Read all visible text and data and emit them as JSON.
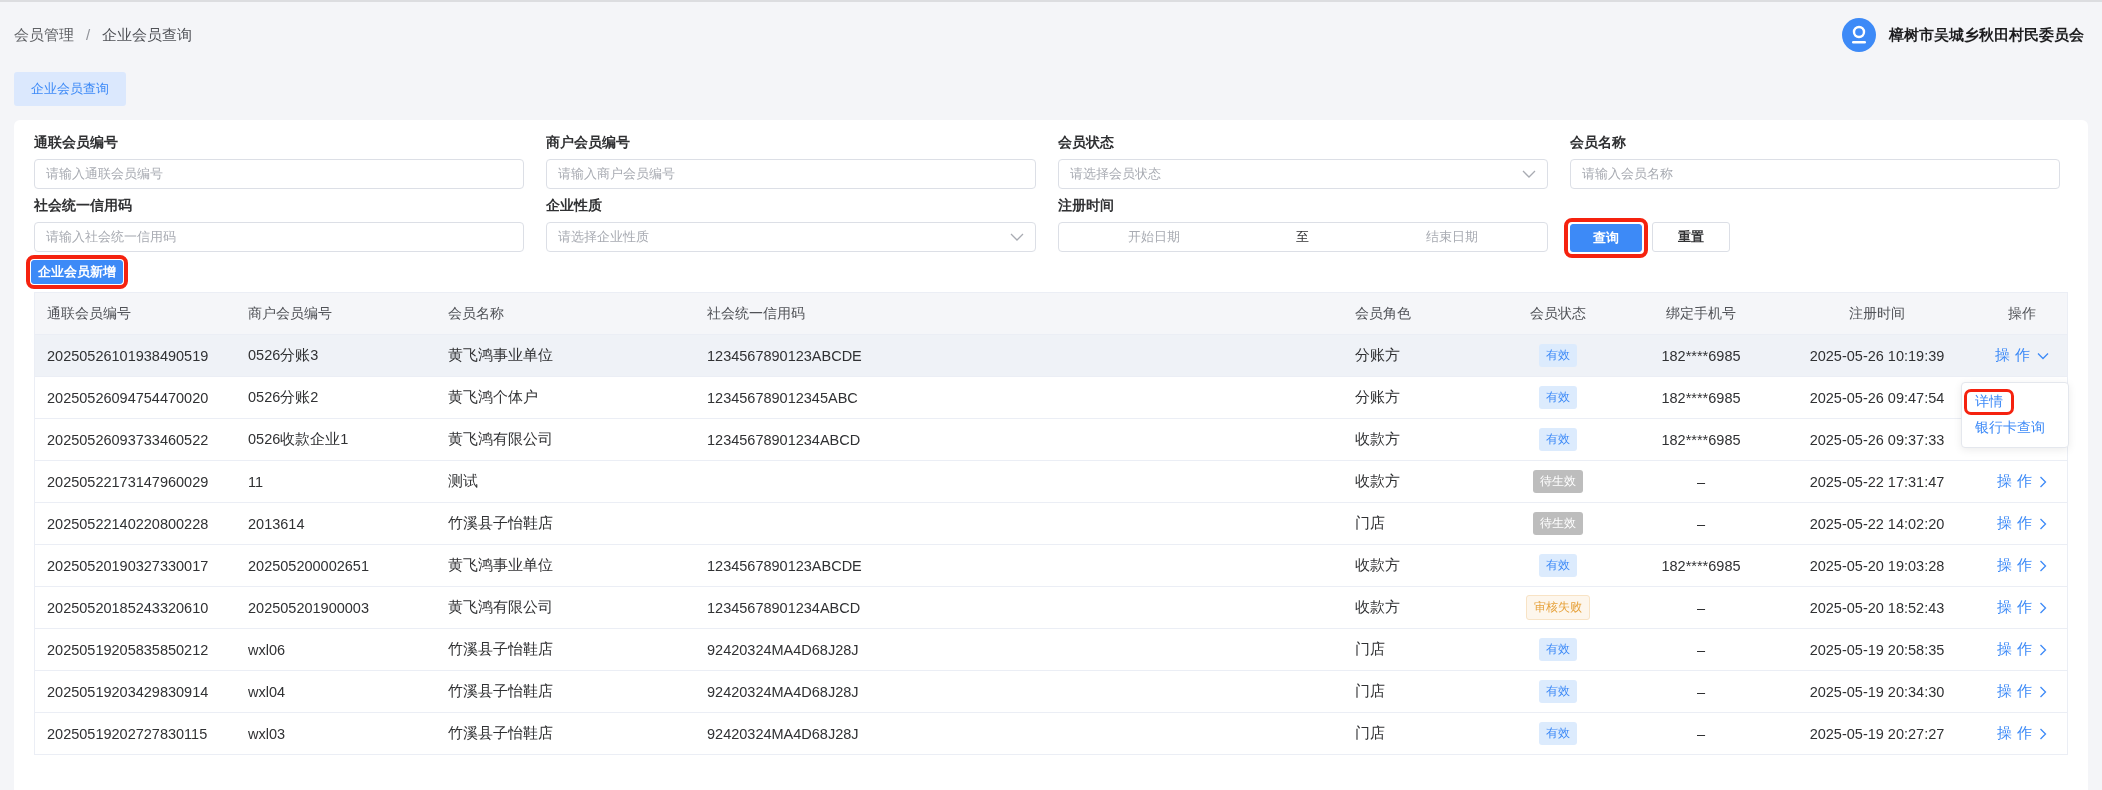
{
  "breadcrumb": [
    "会员管理",
    "企业会员查询"
  ],
  "breadcrumb_separator": "/",
  "user": {
    "name": "樟树市吴城乡秋田村民委员会"
  },
  "tabs": [
    {
      "label": "企业会员查询",
      "selected": true
    }
  ],
  "filters": [
    {
      "label": "通联会员编号",
      "kind": "input",
      "placeholder": "请输入通联会员编号"
    },
    {
      "label": "商户会员编号",
      "kind": "input",
      "placeholder": "请输入商户会员编号"
    },
    {
      "label": "会员状态",
      "kind": "select",
      "placeholder": "请选择会员状态"
    },
    {
      "label": "会员名称",
      "kind": "input",
      "placeholder": "请输入会员名称"
    },
    {
      "label": "社会统一信用码",
      "kind": "input",
      "placeholder": "请输入社会统一信用码"
    },
    {
      "label": "企业性质",
      "kind": "select",
      "placeholder": "请选择企业性质"
    },
    {
      "label": "注册时间",
      "kind": "daterange",
      "start_placeholder": "开始日期",
      "separator": "至",
      "end_placeholder": "结束日期"
    }
  ],
  "query_button": {
    "label": "查询",
    "highlighted": true
  },
  "reset_button": {
    "label": "重置"
  },
  "add_button": {
    "label": "企业会员新增",
    "highlighted": true
  },
  "table": {
    "columns": [
      "通联会员编号",
      "商户会员编号",
      "会员名称",
      "社会统一信用码",
      "会员角色",
      "会员状态",
      "绑定手机号",
      "注册时间",
      "操作"
    ],
    "rows": [
      {
        "id": "20250526101938490519",
        "merchant_id": "0526分账3",
        "name": "黄飞鸿事业单位",
        "credit_code": "1234567890123ABCDE",
        "role": "分账方",
        "status": {
          "label": "有效",
          "kind": "valid"
        },
        "phone": "182****6985",
        "registered": "2025-05-26 10:19:39",
        "action": "操 作",
        "expanded": true,
        "hovered": true
      },
      {
        "id": "20250526094754470020",
        "merchant_id": "0526分账2",
        "name": "黄飞鸿个体户",
        "credit_code": "123456789012345ABC",
        "role": "分账方",
        "status": {
          "label": "有效",
          "kind": "valid"
        },
        "phone": "182****6985",
        "registered": "2025-05-26 09:47:54",
        "expanded": false,
        "hovered": false
      },
      {
        "id": "20250526093733460522",
        "merchant_id": "0526收款企业1",
        "name": "黄飞鸿有限公司",
        "credit_code": "12345678901234ABCD",
        "role": "收款方",
        "status": {
          "label": "有效",
          "kind": "valid"
        },
        "phone": "182****6985",
        "registered": "2025-05-26 09:37:33",
        "expanded": false,
        "hovered": false
      },
      {
        "id": "20250522173147960029",
        "merchant_id": "11",
        "name": "测试",
        "role": "收款方",
        "status": {
          "label": "待生效",
          "kind": "pending"
        },
        "phone": "–",
        "registered": "2025-05-22 17:31:47",
        "action": "操 作",
        "expanded": false,
        "hovered": false
      },
      {
        "id": "20250522140220800228",
        "merchant_id": "2013614",
        "name": "竹溪县子怡鞋店",
        "role": "门店",
        "status": {
          "label": "待生效",
          "kind": "pending"
        },
        "phone": "–",
        "registered": "2025-05-22 14:02:20",
        "action": "操 作",
        "expanded": false,
        "hovered": false
      },
      {
        "id": "20250520190327330017",
        "merchant_id": "202505200002651",
        "name": "黄飞鸿事业单位",
        "credit_code": "1234567890123ABCDE",
        "role": "收款方",
        "status": {
          "label": "有效",
          "kind": "valid"
        },
        "phone": "182****6985",
        "registered": "2025-05-20 19:03:28",
        "action": "操 作",
        "expanded": false,
        "hovered": false
      },
      {
        "id": "20250520185243320610",
        "merchant_id": "202505201900003",
        "name": "黄飞鸿有限公司",
        "credit_code": "12345678901234ABCD",
        "role": "收款方",
        "status": {
          "label": "审核失败",
          "kind": "failed"
        },
        "phone": "–",
        "registered": "2025-05-20 18:52:43",
        "action": "操 作",
        "expanded": false,
        "hovered": false
      },
      {
        "id": "20250519205835850212",
        "merchant_id": "wxl06",
        "name": "竹溪县子怡鞋店",
        "credit_code": "92420324MA4D68J28J",
        "role": "门店",
        "status": {
          "label": "有效",
          "kind": "valid"
        },
        "phone": "–",
        "registered": "2025-05-19 20:58:35",
        "action": "操 作",
        "expanded": false,
        "hovered": false
      },
      {
        "id": "20250519203429830914",
        "merchant_id": "wxl04",
        "name": "竹溪县子怡鞋店",
        "credit_code": "92420324MA4D68J28J",
        "role": "门店",
        "status": {
          "label": "有效",
          "kind": "valid"
        },
        "phone": "–",
        "registered": "2025-05-19 20:34:30",
        "action": "操 作",
        "expanded": false,
        "hovered": false
      },
      {
        "id": "20250519202727830115",
        "merchant_id": "wxl03",
        "name": "竹溪县子怡鞋店",
        "credit_code": "92420324MA4D68J28J",
        "role": "门店",
        "status": {
          "label": "有效",
          "kind": "valid"
        },
        "phone": "–",
        "registered": "2025-05-19 20:27:27",
        "action": "操 作",
        "expanded": false,
        "hovered": false
      }
    ]
  },
  "action_menu": {
    "items": [
      {
        "label": "详情",
        "highlighted": true
      },
      {
        "label": "银行卡查询",
        "highlighted": false
      }
    ]
  }
}
